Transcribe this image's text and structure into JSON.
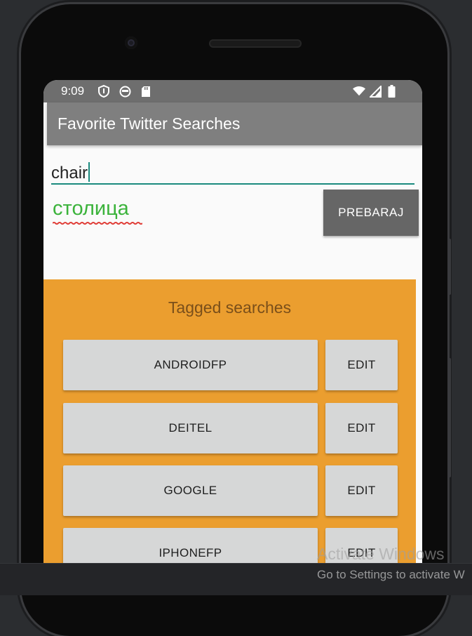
{
  "statusbar": {
    "time": "9:09",
    "left_icons": [
      "shield-icon",
      "face-icon",
      "sd-card-icon"
    ],
    "right_icons": [
      "wifi-icon",
      "signal-icon",
      "battery-icon"
    ]
  },
  "appbar": {
    "title": "Favorite Twitter Searches"
  },
  "form": {
    "query_value": "chair",
    "tag_value": "столица",
    "search_button": "PREBARAJ"
  },
  "tagged": {
    "heading": "Tagged searches",
    "items": [
      {
        "label": "ANDROIDFP",
        "edit": "EDIT"
      },
      {
        "label": "DEITEL",
        "edit": "EDIT"
      },
      {
        "label": "GOOGLE",
        "edit": "EDIT"
      },
      {
        "label": "IPHONEFP",
        "edit": "EDIT"
      }
    ]
  },
  "watermark": {
    "line1": "Activate Windows",
    "line2": "Go to Settings to activate W"
  },
  "colors": {
    "accent": "#1b8a7e",
    "tagged_bg": "#eb9e2f",
    "appbar": "#7f7f7f",
    "tag_text": "#3bb33b"
  }
}
